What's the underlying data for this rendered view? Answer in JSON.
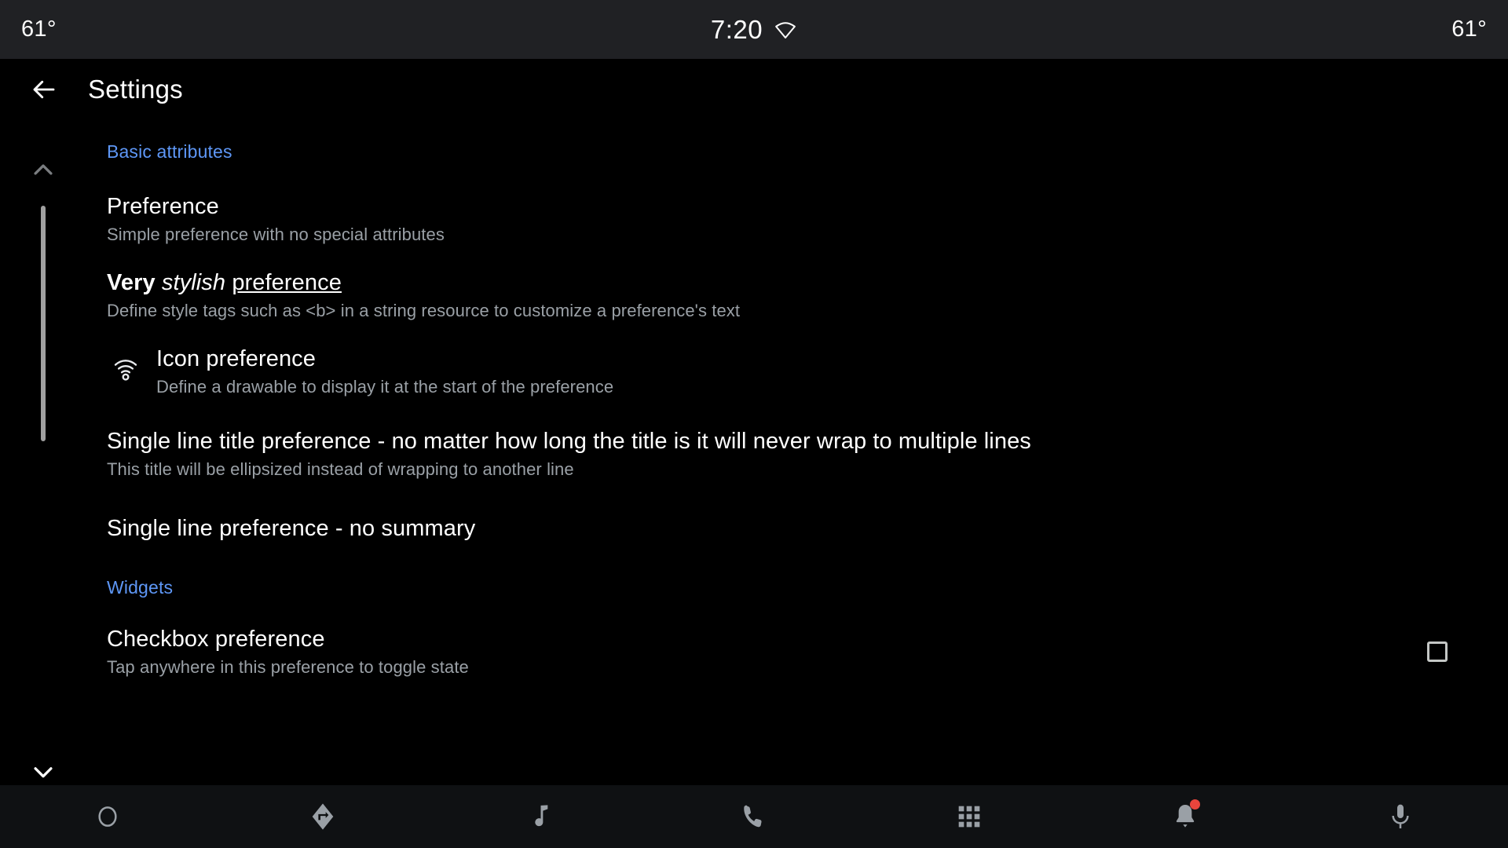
{
  "status_bar": {
    "left_temperature": "61°",
    "right_temperature": "61°",
    "clock": "7:20",
    "wifi_icon": "wifi-no-signal-icon"
  },
  "toolbar": {
    "back_icon": "arrow-back-icon",
    "title": "Settings"
  },
  "scroll": {
    "up_icon": "chevron-up-icon",
    "down_icon": "chevron-down-icon"
  },
  "sections": [
    {
      "header": "Basic attributes",
      "items": [
        {
          "title": "Preference",
          "summary": "Simple preference with no special attributes"
        },
        {
          "title_plain": "Very stylish preference",
          "title_parts": {
            "bold": "Very",
            "italic": "stylish",
            "underline": "preference"
          },
          "summary": "Define style tags such as <b> in a string resource to customize a preference's text"
        },
        {
          "icon": "wifi-icon",
          "title": "Icon preference",
          "summary": "Define a drawable to display it at the start of the preference"
        },
        {
          "title": "Single line title preference - no matter how long the title is it will never wrap to multiple lines",
          "summary": "This title will be ellipsized instead of wrapping to another line"
        },
        {
          "title": "Single line preference - no summary",
          "summary": ""
        }
      ]
    },
    {
      "header": "Widgets",
      "items": [
        {
          "title": "Checkbox preference",
          "summary": "Tap anywhere in this preference to toggle state",
          "widget": "checkbox",
          "checked": false
        }
      ]
    }
  ],
  "nav_bar": {
    "items": [
      {
        "icon": "home-circle-icon",
        "badge": false
      },
      {
        "icon": "navigation-arrow-icon",
        "badge": false
      },
      {
        "icon": "music-note-icon",
        "badge": false
      },
      {
        "icon": "phone-icon",
        "badge": false
      },
      {
        "icon": "apps-grid-icon",
        "badge": false
      },
      {
        "icon": "notifications-bell-icon",
        "badge": true
      },
      {
        "icon": "microphone-icon",
        "badge": false
      }
    ]
  },
  "colors": {
    "background": "#000000",
    "status_bar": "#202124",
    "nav_bar": "#0f1113",
    "accent_blue": "#5e97f6",
    "title_text": "#ffffff",
    "summary_text": "#9aa0a6",
    "badge_red": "#e8453c",
    "scrollbar": "#a0a0a0"
  }
}
